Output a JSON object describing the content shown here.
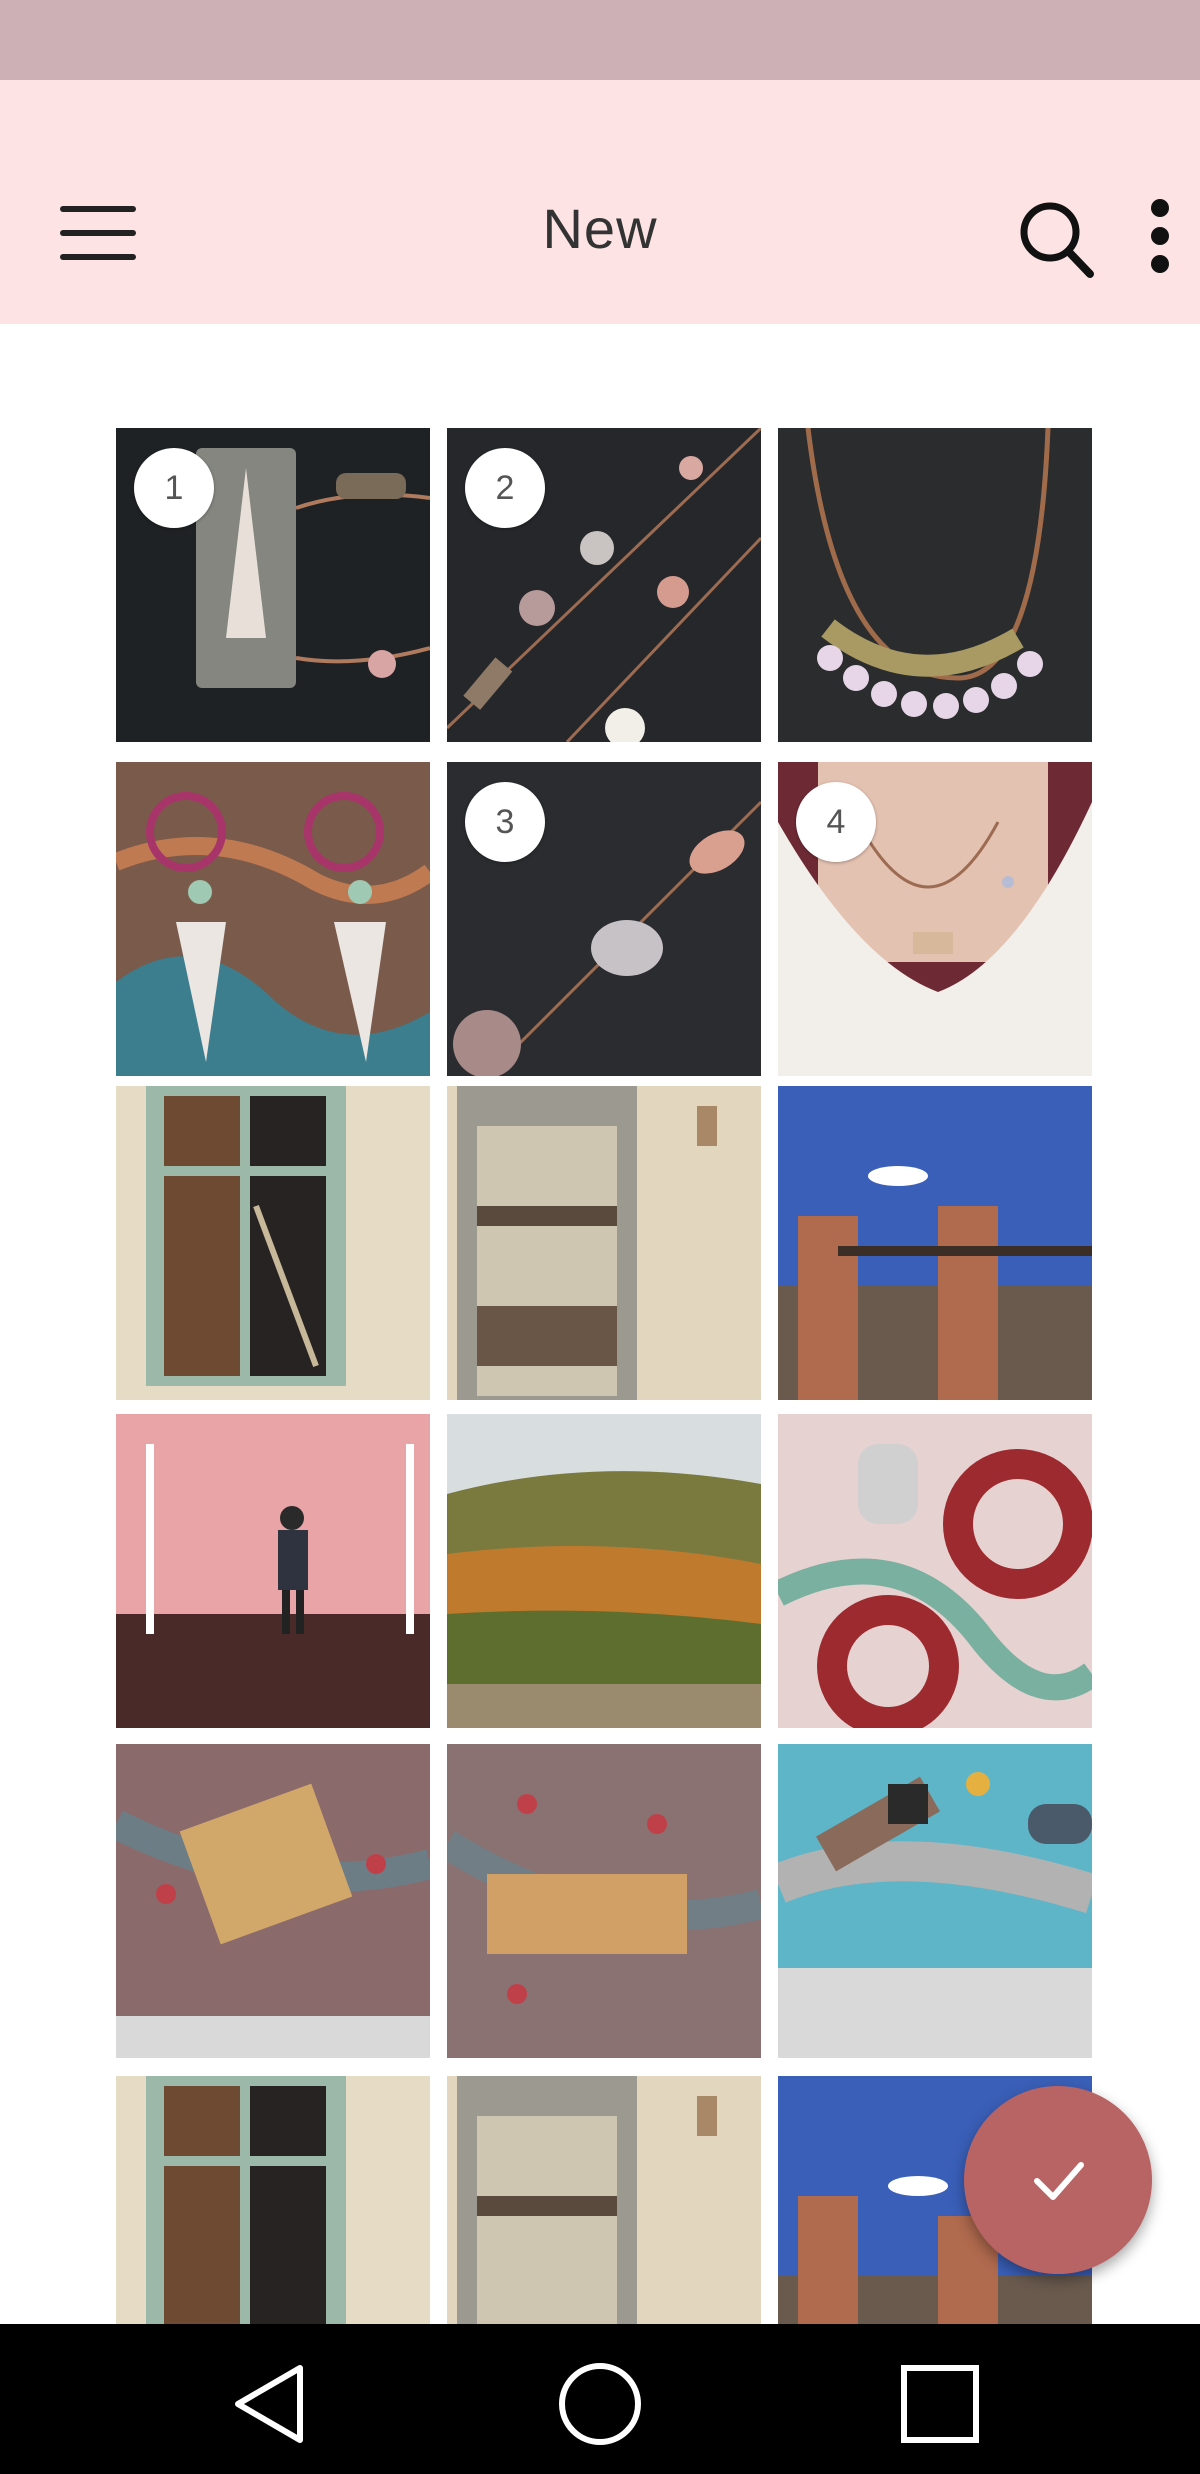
{
  "header": {
    "title": "New"
  },
  "icons": {
    "menu": "menu-icon",
    "search": "search-icon",
    "more": "more-vert-icon",
    "confirm": "check-icon"
  },
  "colors": {
    "status_bar": "#cdb0b6",
    "app_bar": "#fde3e4",
    "fab": "#b86364",
    "nav_bar": "#000000"
  },
  "grid": {
    "tiles": [
      {
        "name": "tile-shell-pendant-necklace",
        "badge": "1"
      },
      {
        "name": "tile-beaded-chain-necklace",
        "badge": "2"
      },
      {
        "name": "tile-pink-crystal-necklace",
        "badge": ""
      },
      {
        "name": "tile-hoop-drop-earrings",
        "badge": ""
      },
      {
        "name": "tile-bead-chain-closeup",
        "badge": "3"
      },
      {
        "name": "tile-necklace-worn",
        "badge": "4"
      },
      {
        "name": "tile-old-window",
        "badge": ""
      },
      {
        "name": "tile-weathered-door",
        "badge": ""
      },
      {
        "name": "tile-brick-ruins",
        "badge": ""
      },
      {
        "name": "tile-person-neon-room",
        "badge": ""
      },
      {
        "name": "tile-autumn-forest",
        "badge": ""
      },
      {
        "name": "tile-red-ring-earrings",
        "badge": ""
      },
      {
        "name": "tile-brass-bar-bracelet",
        "badge": ""
      },
      {
        "name": "tile-brass-bar-necklace",
        "badge": ""
      },
      {
        "name": "tile-key-pendant",
        "badge": ""
      },
      {
        "name": "tile-old-window-2",
        "badge": ""
      },
      {
        "name": "tile-weathered-door-2",
        "badge": ""
      },
      {
        "name": "tile-brick-ruins-2",
        "badge": ""
      }
    ]
  },
  "navigation": {
    "back": "back-triangle-icon",
    "home": "home-circle-icon",
    "recents": "recents-square-icon"
  }
}
